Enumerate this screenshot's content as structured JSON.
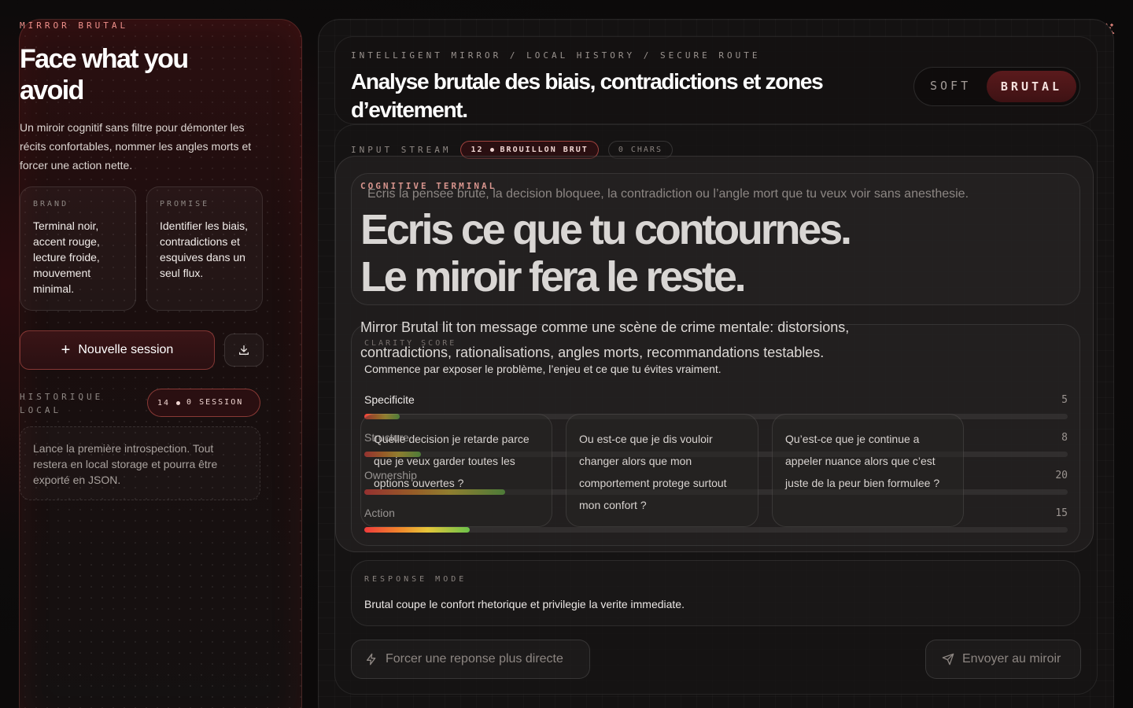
{
  "sidebar": {
    "brand": "MIRROR BRUTAL",
    "title": "Face what you avoid",
    "description": "Un miroir cognitif sans filtre pour démonter les récits confortables, nommer les angles morts et forcer une action nette.",
    "cards": [
      {
        "label": "BRAND",
        "text": "Terminal noir, accent rouge, lecture froide, mouvement minimal."
      },
      {
        "label": "PROMISE",
        "text": "Identifier les biais, contradictions et esquives dans un seul flux."
      }
    ],
    "new_session_label": "Nouvelle session",
    "history_label": "HISTORIQUE LOCAL",
    "history_badge_count": "14",
    "history_badge_text": "0 SESSION",
    "history_empty": "Lance la première introspection. Tout restera en local storage et pourra être exporté en JSON."
  },
  "header": {
    "breadcrumb": "INTELLIGENT MIRROR / LOCAL HISTORY / SECURE ROUTE",
    "title": "Analyse brutale des biais, contradictions et zones d’evitement.",
    "mode_soft": "SOFT",
    "mode_brutal": "BRUTAL"
  },
  "input": {
    "label": "INPUT STREAM",
    "badge_count": "12",
    "badge_text": "BROUILLON BRUT",
    "chars": "0 CHARS",
    "terminal_label": "COGNITIVE TERMINAL",
    "placeholder": "Ecris la pensee brute, la decision bloquee, la contradiction ou l’angle mort que tu veux voir sans anesthesie.",
    "headline_1": "Ecris ce que tu contournes.",
    "headline_2": "Le miroir fera le reste.",
    "mirror_description": "Mirror Brutal lit ton message comme une scène de crime mentale: distorsions, contradictions, rationalisations, angles morts, recommandations testables."
  },
  "clarity": {
    "label": "CLARITY SCORE",
    "subtitle": "Commence par exposer le problème, l’enjeu et ce que tu évites vraiment.",
    "metrics": [
      {
        "name": "Specificite",
        "value": "5",
        "fill": 0.05
      },
      {
        "name": "Structure",
        "value": "8",
        "fill": 0.08
      },
      {
        "name": "Ownership",
        "value": "20",
        "fill": 0.2
      },
      {
        "name": "Action",
        "value": "15",
        "fill": 0.15
      }
    ]
  },
  "questions": [
    "Quelle decision je retarde parce que je veux garder toutes les options ouvertes ?",
    "Ou est-ce que je dis vouloir changer alors que mon comportement protege surtout mon confort ?",
    "Qu’est-ce que je continue a appeler nuance alors que c’est juste de la peur bien formulee ?"
  ],
  "response": {
    "label": "RESPONSE MODE",
    "text": "Brutal coupe le confort rhetorique et privilegie la verite immediate."
  },
  "actions": {
    "force_label": "Forcer une reponse plus directe",
    "send_label": "Envoyer au miroir"
  },
  "colors": {
    "accent": "#ee8f8a",
    "brutal_active": "#5a1a1c"
  },
  "icons": {
    "spark": "sparkle-icon",
    "export": "download-icon",
    "force": "bolt-icon",
    "send": "send-icon"
  }
}
